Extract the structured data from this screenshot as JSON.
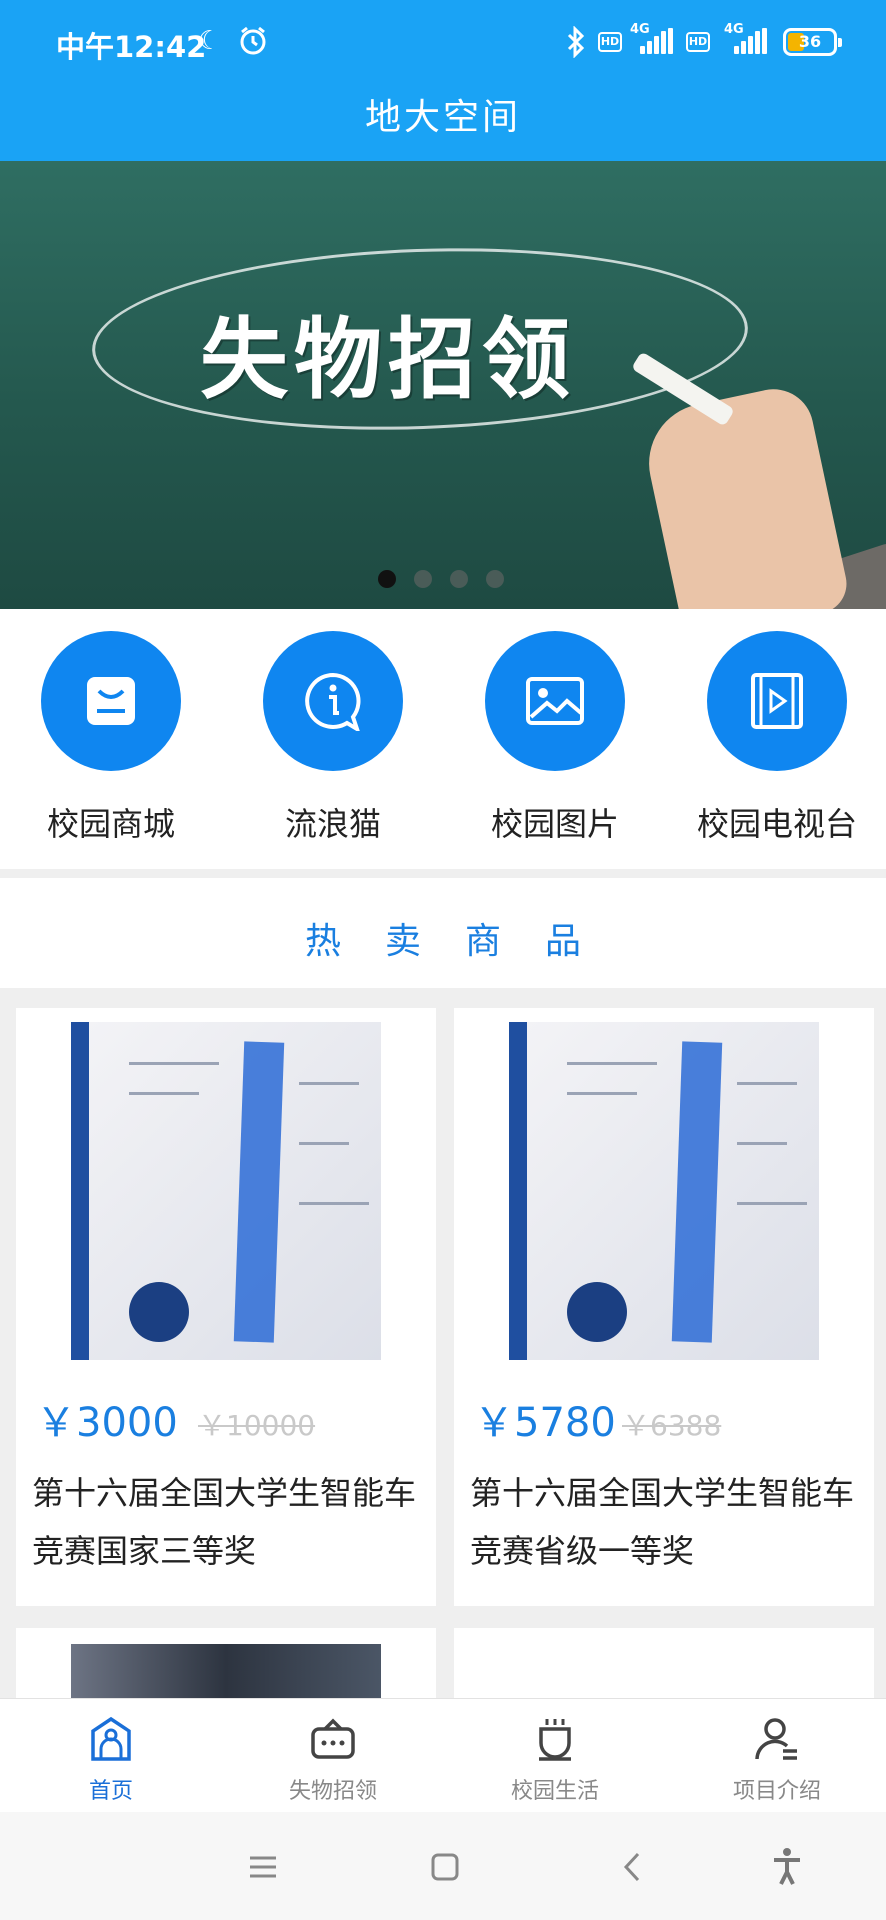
{
  "status_bar": {
    "time": "中午12:42",
    "network_1": "4G",
    "network_2": "4G",
    "hd_1": "HD",
    "hd_2": "HD",
    "battery": "36"
  },
  "header": {
    "title": "地大空间"
  },
  "banner": {
    "title": "失物招领",
    "slides": 4,
    "active_slide": 1
  },
  "quick_menu": [
    {
      "label": "校园商城",
      "icon": "shop-bag-icon"
    },
    {
      "label": "流浪猫",
      "icon": "info-bubble-icon"
    },
    {
      "label": "校园图片",
      "icon": "image-icon"
    },
    {
      "label": "校园电视台",
      "icon": "video-icon"
    }
  ],
  "hot_section": {
    "title": "热卖商品"
  },
  "products": [
    {
      "price": "￥3000",
      "original_price": "￥10000",
      "name": "第十六届全国大学生智能车竞赛国家三等奖"
    },
    {
      "price": "￥5780",
      "original_price": "￥6388",
      "name": "第十六届全国大学生智能车竞赛省级一等奖"
    }
  ],
  "tabbar": [
    {
      "label": "首页",
      "icon": "home-icon",
      "active": true
    },
    {
      "label": "失物招领",
      "icon": "message-box-icon",
      "active": false
    },
    {
      "label": "校园生活",
      "icon": "cup-icon",
      "active": false
    },
    {
      "label": "项目介绍",
      "icon": "profile-icon",
      "active": false
    }
  ],
  "colors": {
    "header": "#1aa3f5",
    "accent": "#0f86f0",
    "price": "#1a7fe0",
    "tab_active": "#1a6fd8"
  }
}
